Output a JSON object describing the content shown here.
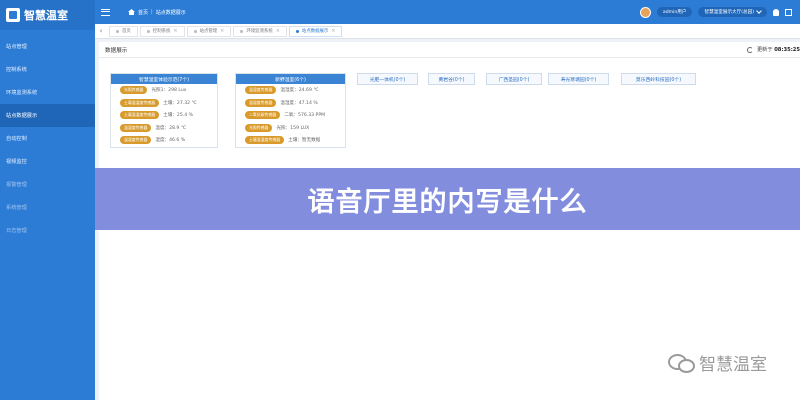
{
  "app": {
    "logo_text": "智慧温室"
  },
  "sidebar": {
    "items": [
      {
        "label": "站点管理"
      },
      {
        "label": "控制系统"
      },
      {
        "label": "环境监测系统"
      },
      {
        "label": "站点数据展示"
      },
      {
        "label": "自动控制"
      },
      {
        "label": "视频监控"
      },
      {
        "label": "报警管理"
      },
      {
        "label": "系统管理"
      },
      {
        "label": "日志管理"
      }
    ]
  },
  "topbar": {
    "breadcrumb_home": "首页",
    "breadcrumb_current": "站点数据展示",
    "user": "admin用户",
    "place": "智慧温室展示大厅(总园)"
  },
  "tabs": [
    {
      "label": "首页"
    },
    {
      "label": "控制系统"
    },
    {
      "label": "站点管理"
    },
    {
      "label": "环境监测系统"
    },
    {
      "label": "站点数据展示"
    }
  ],
  "content": {
    "title": "数据展示",
    "clock": "08:35:25"
  },
  "cards": [
    {
      "title": "智慧温室体验示范(7个)",
      "rows": [
        {
          "badge": "光照传感器",
          "text": "光照1：298 Lux"
        },
        {
          "badge": "土壤温湿度传感器",
          "text": "土壤：27.32 ℃"
        },
        {
          "badge": "土壤温湿度传感器",
          "text": "土壤：25.4 %"
        },
        {
          "badge": "温湿度传感器",
          "text": "温度：28.9 ℃"
        },
        {
          "badge": "温湿度传感器",
          "text": "湿度：46.6 %"
        }
      ]
    },
    {
      "title": "新野温室(6个)",
      "rows": [
        {
          "badge": "温湿度传感器",
          "text": "温湿度：24.69 ℃"
        },
        {
          "badge": "温湿度传感器",
          "text": "温湿度：47.14 %"
        },
        {
          "badge": "二氧化碳传感器",
          "text": "二氧：576.33 PPM"
        },
        {
          "badge": "光照传感器",
          "text": "光照：159 LUX"
        },
        {
          "badge": "土壤温湿度传感器",
          "text": "土壤：暂无数据"
        }
      ]
    }
  ],
  "mini_cards": [
    {
      "label": "光肥一体机(0个)"
    },
    {
      "label": "黄岩谷(0个)"
    },
    {
      "label": "广西圣园(0个)"
    },
    {
      "label": "寿光寒塘园(0个)"
    },
    {
      "label": "莫乐西岭科技园(0个)"
    }
  ],
  "overlay": {
    "headline": "语音厅里的内写是什么",
    "watermark": "智慧温室"
  }
}
